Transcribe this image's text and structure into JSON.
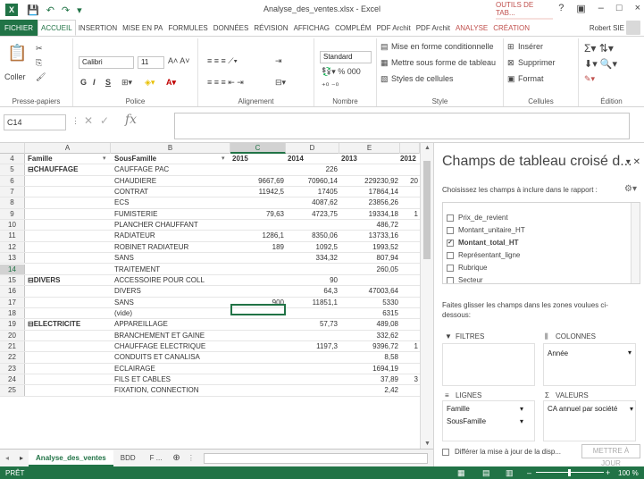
{
  "app": {
    "logo": "X",
    "title": "Analyse_des_ventes.xlsx - Excel",
    "context_tab": "OUTILS DE TAB...",
    "user": "Robert SIE",
    "qat": [
      "💾",
      "↶",
      "↷",
      "▾"
    ],
    "window_controls": [
      "?",
      "▣",
      "–",
      "□",
      "×"
    ]
  },
  "ribbon_tabs": [
    "FICHIER",
    "ACCUEIL",
    "INSERTION",
    "MISE EN PA",
    "FORMULES",
    "DONNÉES",
    "RÉVISION",
    "AFFICHAG",
    "COMPLÉM",
    "PDF Archit",
    "PDF Archit",
    "ANALYSE",
    "CRÉATION"
  ],
  "ribbon": {
    "clipboard": {
      "label": "Presse-papiers",
      "paste": "Coller"
    },
    "font": {
      "label": "Police",
      "name": "Calibri",
      "size": "11",
      "bold": "G",
      "italic": "I",
      "underline": "S"
    },
    "alignment": {
      "label": "Alignement"
    },
    "number": {
      "label": "Nombre",
      "format": "Standard"
    },
    "style": {
      "label": "Style",
      "cond_format": "Mise en forme conditionnelle",
      "format_table": "Mettre sous forme de tableau",
      "cell_styles": "Styles de cellules"
    },
    "cells": {
      "label": "Cellules",
      "insert": "Insérer",
      "delete": "Supprimer",
      "format": "Format"
    },
    "editing": {
      "label": "Édition"
    }
  },
  "formula_bar": {
    "name_box": "C14",
    "fx": "fx",
    "value": ""
  },
  "grid": {
    "columns": [
      "A",
      "B",
      "C",
      "D",
      "E"
    ],
    "header_row": {
      "num": "4",
      "a": "Famille",
      "b": "SousFamille",
      "c": "2015",
      "d": "2014",
      "e": "2013",
      "f": "2012"
    },
    "rows": [
      {
        "num": "5",
        "a": "⊟CHAUFFAGE",
        "b": "CAUFFAGE PAC",
        "c": "",
        "d": "226",
        "e": "",
        "f": ""
      },
      {
        "num": "6",
        "a": "",
        "b": "CHAUDIERE",
        "c": "9667,69",
        "d": "70960,14",
        "e": "229230,92",
        "f": "20"
      },
      {
        "num": "7",
        "a": "",
        "b": "CONTRAT",
        "c": "11942,5",
        "d": "17405",
        "e": "17864,14",
        "f": ""
      },
      {
        "num": "8",
        "a": "",
        "b": "ECS",
        "c": "",
        "d": "4087,62",
        "e": "23856,26",
        "f": ""
      },
      {
        "num": "9",
        "a": "",
        "b": "FUMISTERIE",
        "c": "79,63",
        "d": "4723,75",
        "e": "19334,18",
        "f": "1"
      },
      {
        "num": "10",
        "a": "",
        "b": "PLANCHER CHAUFFANT",
        "c": "",
        "d": "",
        "e": "486,72",
        "f": ""
      },
      {
        "num": "11",
        "a": "",
        "b": "RADIATEUR",
        "c": "1286,1",
        "d": "8350,06",
        "e": "13733,16",
        "f": ""
      },
      {
        "num": "12",
        "a": "",
        "b": "ROBINET RADIATEUR",
        "c": "189",
        "d": "1092,5",
        "e": "1993,52",
        "f": ""
      },
      {
        "num": "13",
        "a": "",
        "b": "SANS",
        "c": "",
        "d": "334,32",
        "e": "807,94",
        "f": ""
      },
      {
        "num": "14",
        "a": "",
        "b": "TRAITEMENT",
        "c": "",
        "d": "",
        "e": "260,05",
        "f": ""
      },
      {
        "num": "15",
        "a": "⊟DIVERS",
        "b": "ACCESSOIRE POUR COLL",
        "c": "",
        "d": "90",
        "e": "",
        "f": ""
      },
      {
        "num": "16",
        "a": "",
        "b": "DIVERS",
        "c": "",
        "d": "64,3",
        "e": "47003,64",
        "f": ""
      },
      {
        "num": "17",
        "a": "",
        "b": "SANS",
        "c": "900",
        "d": "11851,1",
        "e": "5330",
        "f": ""
      },
      {
        "num": "18",
        "a": "",
        "b": "(vide)",
        "c": "",
        "d": "",
        "e": "6315",
        "f": ""
      },
      {
        "num": "19",
        "a": "⊟ELECTRICITE",
        "b": "APPAREILLAGE",
        "c": "",
        "d": "57,73",
        "e": "489,08",
        "f": ""
      },
      {
        "num": "20",
        "a": "",
        "b": "BRANCHEMENT ET GAINE",
        "c": "",
        "d": "",
        "e": "332,62",
        "f": ""
      },
      {
        "num": "21",
        "a": "",
        "b": "CHAUFFAGE ELECTRIQUE",
        "c": "",
        "d": "1197,3",
        "e": "9396,72",
        "f": "1"
      },
      {
        "num": "22",
        "a": "",
        "b": "CONDUITS ET CANALISA",
        "c": "",
        "d": "",
        "e": "8,58",
        "f": ""
      },
      {
        "num": "23",
        "a": "",
        "b": "ECLAIRAGE",
        "c": "",
        "d": "",
        "e": "1694,19",
        "f": ""
      },
      {
        "num": "24",
        "a": "",
        "b": "FILS ET CABLES",
        "c": "",
        "d": "",
        "e": "37,89",
        "f": "3"
      },
      {
        "num": "25",
        "a": "",
        "b": "FIXATION, CONNECTION",
        "c": "",
        "d": "",
        "e": "2,42",
        "f": ""
      }
    ]
  },
  "sheet_tabs": [
    "Analyse_des_ventes",
    "BDD",
    "F ..."
  ],
  "status": {
    "ready": "PRÊT",
    "zoom": "100 %"
  },
  "pivot_pane": {
    "title": "Champs de tableau croisé d...",
    "subtitle": "Choisissez les champs à inclure dans le rapport :",
    "fields": [
      {
        "label": "Prix_de_revient",
        "checked": false
      },
      {
        "label": "Montant_unitaire_HT",
        "checked": false
      },
      {
        "label": "Montant_total_HT",
        "checked": true
      },
      {
        "label": "Représentant_ligne",
        "checked": false
      },
      {
        "label": "Rubrique",
        "checked": false
      },
      {
        "label": "Secteur",
        "checked": false
      }
    ],
    "drag_hint": "Faites glisser les champs dans les zones voulues ci-dessous:",
    "zones": {
      "filters": "FILTRES",
      "columns": "COLONNES",
      "columns_items": [
        "Année"
      ],
      "rows": "LIGNES",
      "rows_items": [
        "Famille",
        "SousFamille"
      ],
      "values": "VALEURS",
      "values_items": [
        "CA annuel par société"
      ]
    },
    "defer": "Différer la mise à jour de la disp...",
    "update_button": "METTRE À JOUR"
  },
  "colors": {
    "accent": "#217346",
    "context": "#c0504d"
  }
}
